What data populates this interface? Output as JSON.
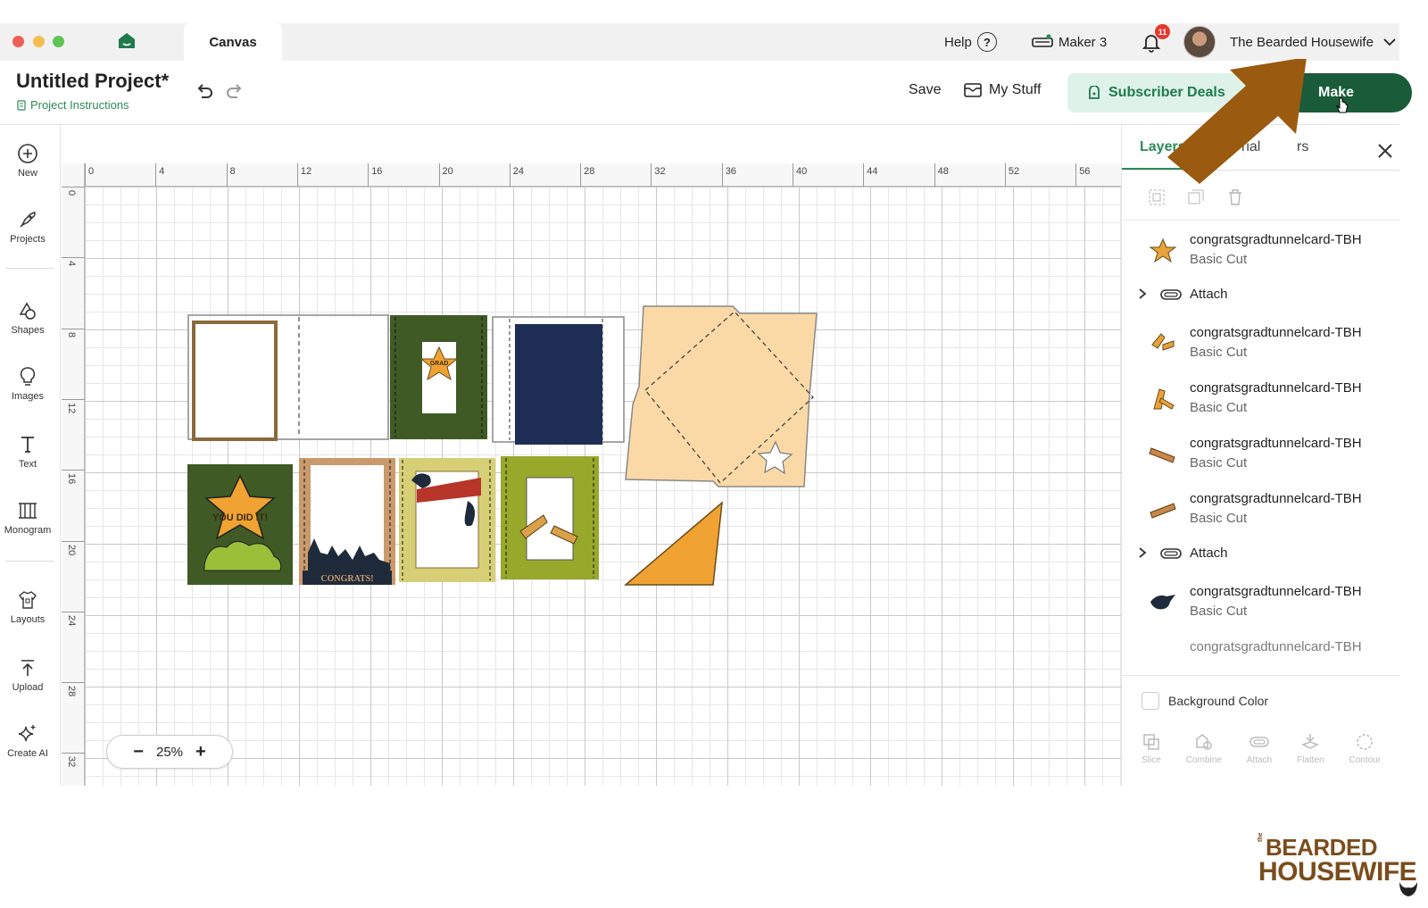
{
  "tabbar": {
    "tab": "Canvas",
    "help": "Help",
    "help_icon": "?",
    "machine": "Maker 3",
    "notifications": "11",
    "user": "The Bearded Housewife"
  },
  "header": {
    "title": "Untitled Project*",
    "instructions": "Project Instructions",
    "save": "Save",
    "my_stuff": "My Stuff",
    "subscriber_deals": "Subscriber Deals",
    "make": "Make"
  },
  "sidebar": {
    "items": [
      {
        "label": "New",
        "icon": "plus-circle-icon"
      },
      {
        "label": "Projects",
        "icon": "rocket-icon"
      },
      {
        "label": "Shapes",
        "icon": "shapes-icon"
      },
      {
        "label": "Images",
        "icon": "bulb-icon"
      },
      {
        "label": "Text",
        "icon": "text-icon"
      },
      {
        "label": "Monogram",
        "icon": "monogram-icon"
      },
      {
        "label": "Layouts",
        "icon": "shirt-icon"
      },
      {
        "label": "Upload",
        "icon": "upload-icon"
      },
      {
        "label": "Create AI",
        "icon": "sparkle-icon"
      }
    ]
  },
  "canvas": {
    "ruler_top": [
      "0",
      "4",
      "8",
      "12",
      "16",
      "20",
      "24",
      "28",
      "32",
      "36",
      "40",
      "44",
      "48",
      "52",
      "56"
    ],
    "ruler_left": [
      "0",
      "4",
      "8",
      "12",
      "16",
      "20",
      "24",
      "28",
      "32"
    ],
    "zoom": "25%",
    "card_texts": {
      "grad": "GRAD",
      "you_did_it": "YOU DID IT!",
      "congrats": "CONGRATS!"
    }
  },
  "panel": {
    "tabs": [
      "Layers",
      "rial",
      "rs"
    ],
    "layers": [
      {
        "name": "congratsgradtunnelcard-TBH",
        "op": "Basic Cut",
        "thumb": "star-thumb",
        "color": "#e8a23a"
      },
      {
        "group": "Attach"
      },
      {
        "name": "congratsgradtunnelcard-TBH",
        "op": "Basic Cut",
        "thumb": "diploma-thumb",
        "color": "#e8a23a"
      },
      {
        "name": "congratsgradtunnelcard-TBH",
        "op": "Basic Cut",
        "thumb": "diploma-thumb",
        "color": "#e8a23a"
      },
      {
        "name": "congratsgradtunnelcard-TBH",
        "op": "Basic Cut",
        "thumb": "scroll-thumb",
        "color": "#c9874a"
      },
      {
        "name": "congratsgradtunnelcard-TBH",
        "op": "Basic Cut",
        "thumb": "scroll-thumb",
        "color": "#c9874a"
      },
      {
        "group": "Attach"
      },
      {
        "name": "congratsgradtunnelcard-TBH",
        "op": "Basic Cut",
        "thumb": "grad-cap-thumb",
        "color": "#1f2b3a"
      }
    ],
    "background_color": "Background Color",
    "bottom_tools": [
      "Slice",
      "Combine",
      "Attach",
      "Flatten",
      "Contour"
    ]
  },
  "watermark": {
    "small": "the",
    "line1": "BEARDED",
    "line2": "HOUSEWIFE"
  },
  "colors": {
    "brand_green": "#1a5c3a",
    "accent_green": "#2c8a57",
    "arrow": "#9a5a0f",
    "card_dark_green": "#3f5a25",
    "card_olive": "#97a82b",
    "card_navy": "#1f2e55",
    "card_peach": "#fbd9a6",
    "card_orange": "#f0a332"
  }
}
